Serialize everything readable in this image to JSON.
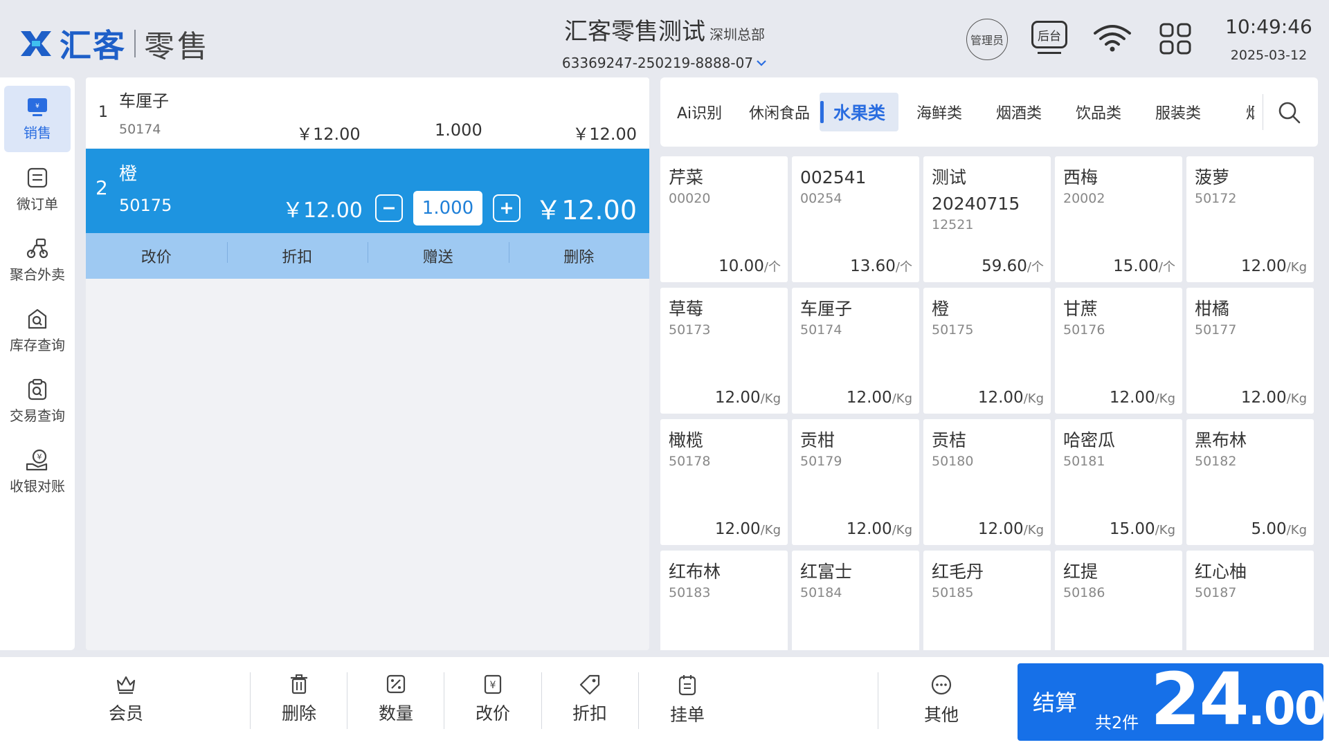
{
  "header": {
    "brand": "汇客",
    "product": "零售",
    "store_name": "汇客零售测试",
    "store_branch": "深圳总部",
    "store_id": "63369247-250219-8888-07",
    "admin_label": "管理员",
    "backend_label": "后台",
    "time": "10:49:46",
    "date": "2025-03-12"
  },
  "sidebar": {
    "items": [
      {
        "label": "销售",
        "icon": "sales-icon",
        "active": true
      },
      {
        "label": "微订单",
        "icon": "order-icon"
      },
      {
        "label": "聚合外卖",
        "icon": "delivery-icon"
      },
      {
        "label": "库存查询",
        "icon": "inventory-icon"
      },
      {
        "label": "交易查询",
        "icon": "transaction-icon"
      },
      {
        "label": "收银对账",
        "icon": "reconcile-icon"
      }
    ]
  },
  "cart": {
    "items": [
      {
        "index": "1",
        "name": "车厘子",
        "code": "50174",
        "price": "￥12.00",
        "qty": "1.000",
        "total": "￥12.00"
      },
      {
        "index": "2",
        "name": "橙",
        "code": "50175",
        "price": "￥12.00",
        "qty": "1.000",
        "total": "￥12.00"
      }
    ],
    "actions": [
      "改价",
      "折扣",
      "赠送",
      "删除"
    ]
  },
  "categories": {
    "items": [
      "Ai识别",
      "休闲食品",
      "水果类",
      "海鲜类",
      "烟酒类",
      "饮品类",
      "服装类",
      "烟"
    ],
    "active": "水果类"
  },
  "products": [
    {
      "name": "芹菜",
      "code": "00020",
      "price": "10.00",
      "unit": "/个"
    },
    {
      "name": "002541",
      "code": "00254",
      "price": "13.60",
      "unit": "/个"
    },
    {
      "name": "测试20240715",
      "code": "12521",
      "price": "59.60",
      "unit": "/个"
    },
    {
      "name": "西梅",
      "code": "20002",
      "price": "15.00",
      "unit": "/个"
    },
    {
      "name": "菠萝",
      "code": "50172",
      "price": "12.00",
      "unit": "/Kg"
    },
    {
      "name": "草莓",
      "code": "50173",
      "price": "12.00",
      "unit": "/Kg"
    },
    {
      "name": "车厘子",
      "code": "50174",
      "price": "12.00",
      "unit": "/Kg"
    },
    {
      "name": "橙",
      "code": "50175",
      "price": "12.00",
      "unit": "/Kg"
    },
    {
      "name": "甘蔗",
      "code": "50176",
      "price": "12.00",
      "unit": "/Kg"
    },
    {
      "name": "柑橘",
      "code": "50177",
      "price": "12.00",
      "unit": "/Kg"
    },
    {
      "name": "橄榄",
      "code": "50178",
      "price": "12.00",
      "unit": "/Kg"
    },
    {
      "name": "贡柑",
      "code": "50179",
      "price": "12.00",
      "unit": "/Kg"
    },
    {
      "name": "贡桔",
      "code": "50180",
      "price": "12.00",
      "unit": "/Kg"
    },
    {
      "name": "哈密瓜",
      "code": "50181",
      "price": "15.00",
      "unit": "/Kg"
    },
    {
      "name": "黑布林",
      "code": "50182",
      "price": "5.00",
      "unit": "/Kg"
    },
    {
      "name": "红布林",
      "code": "50183",
      "price": "",
      "unit": ""
    },
    {
      "name": "红富士",
      "code": "50184",
      "price": "",
      "unit": ""
    },
    {
      "name": "红毛丹",
      "code": "50185",
      "price": "",
      "unit": ""
    },
    {
      "name": "红提",
      "code": "50186",
      "price": "",
      "unit": ""
    },
    {
      "name": "红心柚",
      "code": "50187",
      "price": "",
      "unit": ""
    }
  ],
  "footer": {
    "buttons": [
      {
        "label": "会员",
        "icon": "member-icon"
      },
      {
        "label": "删除",
        "icon": "trash-icon"
      },
      {
        "label": "数量",
        "icon": "quantity-icon"
      },
      {
        "label": "改价",
        "icon": "price-change-icon"
      },
      {
        "label": "折扣",
        "icon": "discount-icon"
      },
      {
        "label": "挂单",
        "icon": "hold-order-icon"
      },
      {
        "label": "其他",
        "icon": "more-icon"
      }
    ],
    "checkout_label": "结算",
    "item_count": "共2件",
    "total_int": "24",
    "total_dec": ".00"
  },
  "colors": {
    "accent": "#1670e8",
    "selected_row": "#1e94e0",
    "row_actions": "#9ec9f2"
  }
}
